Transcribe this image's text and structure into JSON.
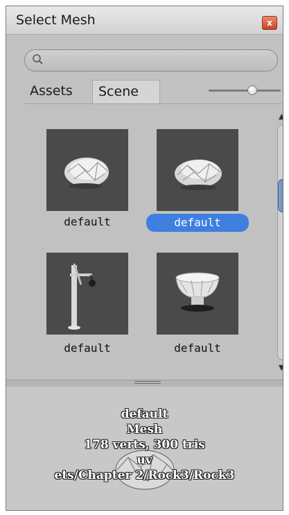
{
  "window": {
    "title": "Select Mesh",
    "close_label": "x"
  },
  "search": {
    "value": "",
    "placeholder": ""
  },
  "tabs": [
    {
      "label": "Assets",
      "active": false
    },
    {
      "label": "Scene",
      "active": true
    }
  ],
  "zoom_slider": {
    "value": 0.62
  },
  "items": [
    {
      "label": "default",
      "selected": false,
      "icon": "rock-mesh-icon"
    },
    {
      "label": "default",
      "selected": true,
      "icon": "rock-mesh-icon"
    },
    {
      "label": "default",
      "selected": false,
      "icon": "lamp-post-mesh-icon"
    },
    {
      "label": "default",
      "selected": false,
      "icon": "fountain-mesh-icon"
    }
  ],
  "scrollbar": {
    "position": 0.27
  },
  "preview": {
    "name": "default",
    "type": "Mesh",
    "stats": "178 verts, 300 tris",
    "channels": "uv",
    "path": "ets/Chapter 2/Rock3/Rock3"
  },
  "colors": {
    "selection": "#3f7fe0",
    "thumbnail_bg": "#4a4a4a",
    "panel_bg": "#c2c2c2"
  }
}
